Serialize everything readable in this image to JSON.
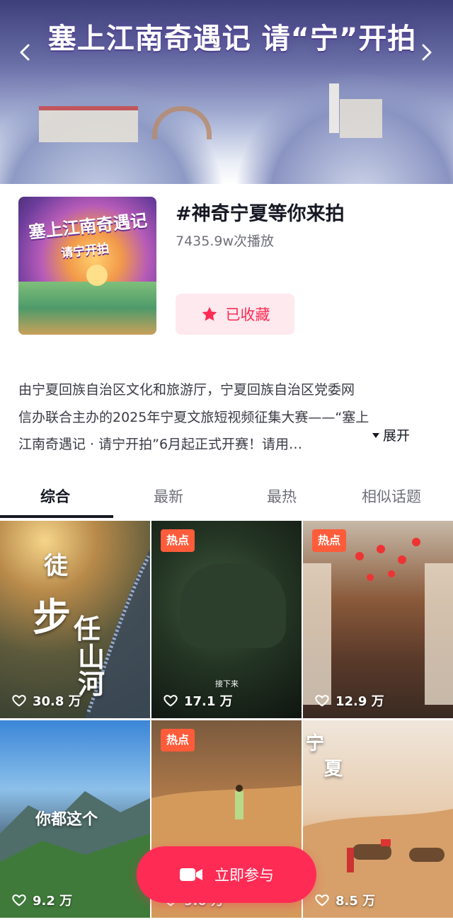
{
  "banner": {
    "title": "塞上江南奇遇记 请“宁”开拍"
  },
  "topic": {
    "cover_text_1": "塞上江南奇遇记",
    "cover_text_2": "请宁开拍",
    "title": "#神奇宁夏等你来拍",
    "play_count": "7435.9w次播放",
    "favorite_label": "已收藏",
    "description_lines": [
      "由宁夏回族自治区文化和旅游厅，宁夏回族自治区党委网",
      "信办联合主办的2025年宁夏文旅短视频征集大赛——“塞上",
      "江南奇遇记 · 请宁开拍”6月起正式开赛！请用…"
    ],
    "expand_label": "展开"
  },
  "tabs": [
    "综合",
    "最新",
    "最热",
    "相似话题"
  ],
  "videos": [
    {
      "likes": "30.8 万",
      "badge": "",
      "overlay": [
        "徒",
        "步",
        "任",
        "山",
        "河"
      ]
    },
    {
      "likes": "17.1 万",
      "badge": "热点",
      "overlay": [
        "接下来"
      ]
    },
    {
      "likes": "12.9 万",
      "badge": "热点",
      "overlay": []
    },
    {
      "likes": "9.2 万",
      "badge": "",
      "overlay": [
        "你都这个"
      ]
    },
    {
      "likes": "9.0 万",
      "badge": "热点",
      "overlay": []
    },
    {
      "likes": "8.5 万",
      "badge": "",
      "overlay": [
        "宁",
        "夏"
      ]
    }
  ],
  "join_button": {
    "label": "立即参与"
  },
  "colors": {
    "accent": "#fe2c55",
    "hot_badge": "#fe5c3a",
    "text_primary": "#161823",
    "text_secondary": "#6f7078"
  }
}
